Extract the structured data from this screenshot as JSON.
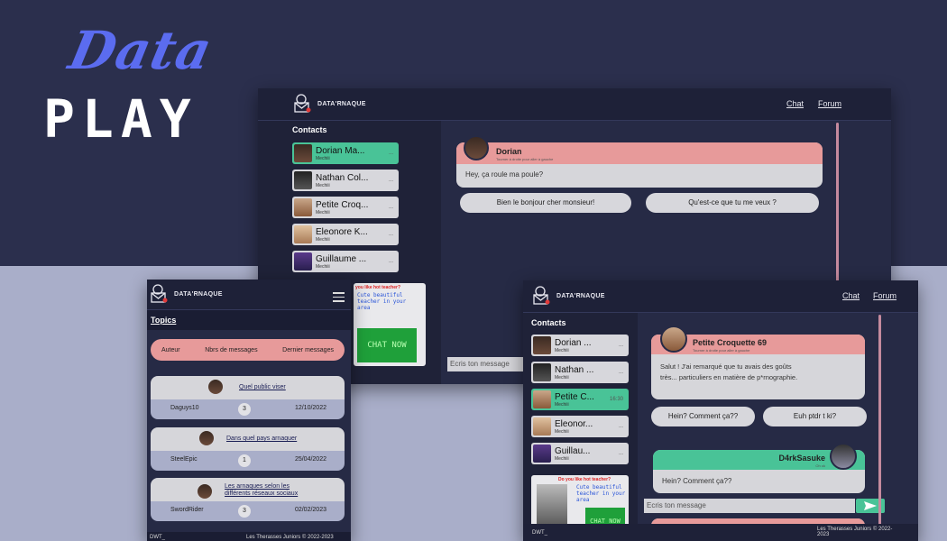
{
  "brand": {
    "word1": "Data",
    "word2": "PLAY"
  },
  "app": {
    "logo_text": "DATA'RNAQUE"
  },
  "nav": {
    "chat": "Chat",
    "forum": "Forum"
  },
  "chat_main": {
    "contacts_title": "Contacts",
    "contacts": [
      {
        "name": "Dorian Ma...",
        "sub": "Mechiii",
        "time": "..."
      },
      {
        "name": "Nathan Col...",
        "sub": "Mechiii",
        "time": "..."
      },
      {
        "name": "Petite Croq...",
        "sub": "Mechiii",
        "time": "..."
      },
      {
        "name": "Eleonore K...",
        "sub": "Mechiii",
        "time": "..."
      },
      {
        "name": "Guillaume ...",
        "sub": "Mechiii",
        "time": "..."
      }
    ],
    "conversation": {
      "name": "Dorian",
      "subtitle": "Tourner à droite pour aller à gauche",
      "message": "Hey, ça roule ma poule?",
      "replies": [
        "Bien le bonjour cher monsieur!",
        "Qu'est-ce que tu me veux ?"
      ]
    },
    "ad": {
      "question": "you like hot teacher?",
      "text": "Cute beautiful teacher in your area",
      "button": "CHAT NOW"
    },
    "input_placeholder": "Ecris ton message"
  },
  "chat_second": {
    "contacts_title": "Contacts",
    "contacts": [
      {
        "name": "Dorian ...",
        "sub": "Mechiii",
        "time": "..."
      },
      {
        "name": "Nathan ...",
        "sub": "Mechiii",
        "time": "..."
      },
      {
        "name": "Petite C...",
        "sub": "Mechiii",
        "time": "16:30"
      },
      {
        "name": "Eleonor...",
        "sub": "Mechiii",
        "time": "..."
      },
      {
        "name": "Guillau...",
        "sub": "Mechiii",
        "time": "..."
      }
    ],
    "conversation": {
      "name": "Petite Croquette 69",
      "subtitle": "Tourner à droite pour aller à gauche",
      "message": "Salut ! J'ai remarqué que tu avais des goûts très... particuliers en matière de p*rnographie.",
      "replies": [
        "Hein? Comment ça??",
        "Euh ptdr t ki?"
      ],
      "reply_name": "D4rkSasuke",
      "reply_sub": "Oh ok",
      "reply_message": "Hein? Comment ça??"
    },
    "ad": {
      "question": "Do you like hot teacher?",
      "text": "Cute beautiful teacher in your area",
      "button": "CHAT NOW"
    },
    "input_placeholder": "Ecris ton message",
    "footer_left": "DWT_",
    "footer_right": "Les Therasses Juniors © 2022-2023"
  },
  "forum": {
    "topics_label": "Topics",
    "headers": {
      "author": "Auteur",
      "count": "Nbrs de messages",
      "last": "Dernier messages"
    },
    "topics": [
      {
        "title": "Quel public viser",
        "author": "Daguys10",
        "count": "3",
        "date": "12/10/2022"
      },
      {
        "title": "Dans quel pays arnaquer",
        "author": "SteelEpic",
        "count": "1",
        "date": "25/04/2022"
      },
      {
        "title": "Les arnaques selon les différents réseaux sociaux",
        "author": "SwordRider",
        "count": "3",
        "date": "02/02/2023"
      }
    ],
    "footer_left": "DWT_",
    "footer_right": "Les Therasses Juniors © 2022-2023"
  },
  "colors": {
    "accent_pink": "#e79a9a",
    "accent_green": "#49c397",
    "brand_blue": "#5b6cf0",
    "panel": "#262a45"
  }
}
